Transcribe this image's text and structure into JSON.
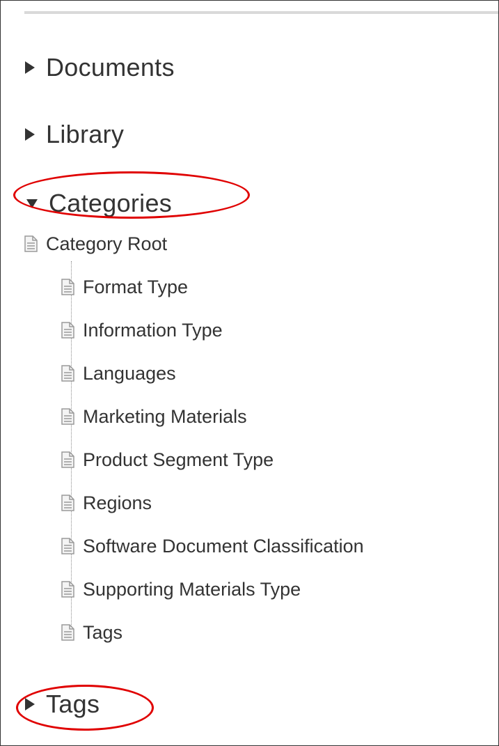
{
  "sections": {
    "documents": "Documents",
    "library": "Library",
    "categories": "Categories",
    "tags": "Tags"
  },
  "tree": {
    "root": "Category Root",
    "children": [
      "Format Type",
      "Information Type",
      "Languages",
      "Marketing Materials",
      "Product Segment Type",
      "Regions",
      "Software Document Classification",
      "Supporting Materials Type",
      "Tags"
    ]
  },
  "icons": {
    "collapsed": "triangle-right-icon",
    "expanded": "triangle-down-icon",
    "node": "document-icon"
  },
  "colors": {
    "text": "#333333",
    "highlight": "#e00000",
    "divider": "#d9d9d9"
  }
}
